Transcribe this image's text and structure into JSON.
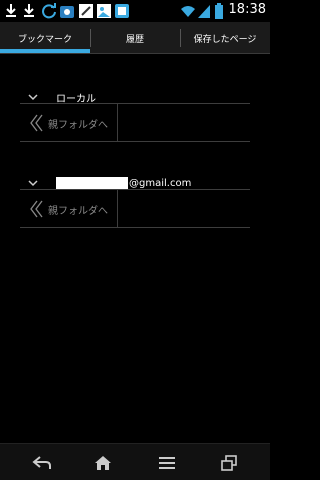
{
  "status_bar": {
    "time": "18:38",
    "icons": [
      "download-icon",
      "download-icon",
      "sync-icon",
      "app-icon",
      "note-icon",
      "image-icon",
      "app-icon",
      "wifi-icon",
      "signal-icon",
      "battery-icon"
    ]
  },
  "tabs": [
    {
      "label": "ブックマーク",
      "selected": true
    },
    {
      "label": "履歴",
      "selected": false
    },
    {
      "label": "保存したページ",
      "selected": false
    }
  ],
  "accent_color": "#3aa9e0",
  "groups": [
    {
      "title": "ローカル",
      "parent_label": "親フォルダへ"
    },
    {
      "title": "@gmail.com",
      "parent_label": "親フォルダへ"
    }
  ],
  "nav_bar": {
    "buttons": [
      "back-icon",
      "home-icon",
      "menu-icon",
      "recent-apps-icon"
    ]
  }
}
